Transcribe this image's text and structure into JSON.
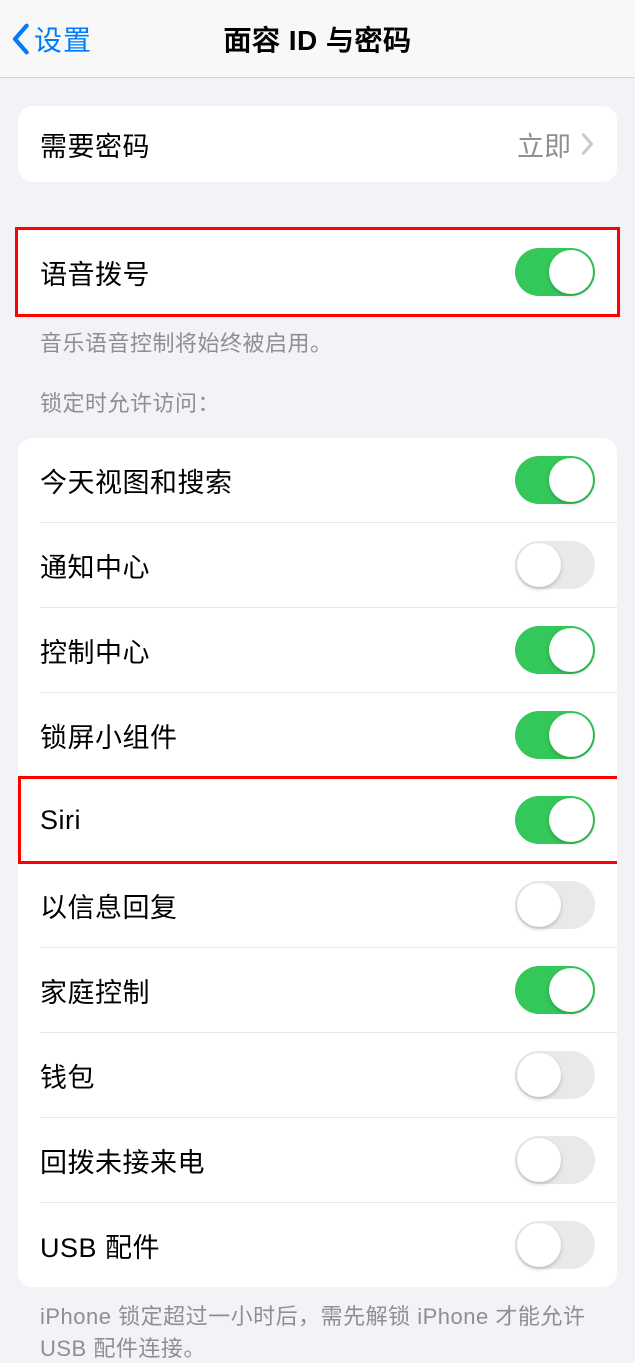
{
  "navbar": {
    "back_label": "设置",
    "title": "面容 ID 与密码"
  },
  "passcode_section": {
    "require_passcode_label": "需要密码",
    "require_passcode_value": "立即"
  },
  "voice_dial_section": {
    "label": "语音拨号",
    "on": true,
    "footer": "音乐语音控制将始终被启用。"
  },
  "lock_access": {
    "header": "锁定时允许访问：",
    "items": [
      {
        "label": "今天视图和搜索",
        "on": true
      },
      {
        "label": "通知中心",
        "on": false
      },
      {
        "label": "控制中心",
        "on": true
      },
      {
        "label": "锁屏小组件",
        "on": true
      },
      {
        "label": "Siri",
        "on": true,
        "highlighted": true
      },
      {
        "label": "以信息回复",
        "on": false
      },
      {
        "label": "家庭控制",
        "on": true
      },
      {
        "label": "钱包",
        "on": false
      },
      {
        "label": "回拨未接来电",
        "on": false
      },
      {
        "label": "USB 配件",
        "on": false
      }
    ],
    "footer": "iPhone 锁定超过一小时后，需先解锁 iPhone 才能允许USB 配件连接。"
  }
}
